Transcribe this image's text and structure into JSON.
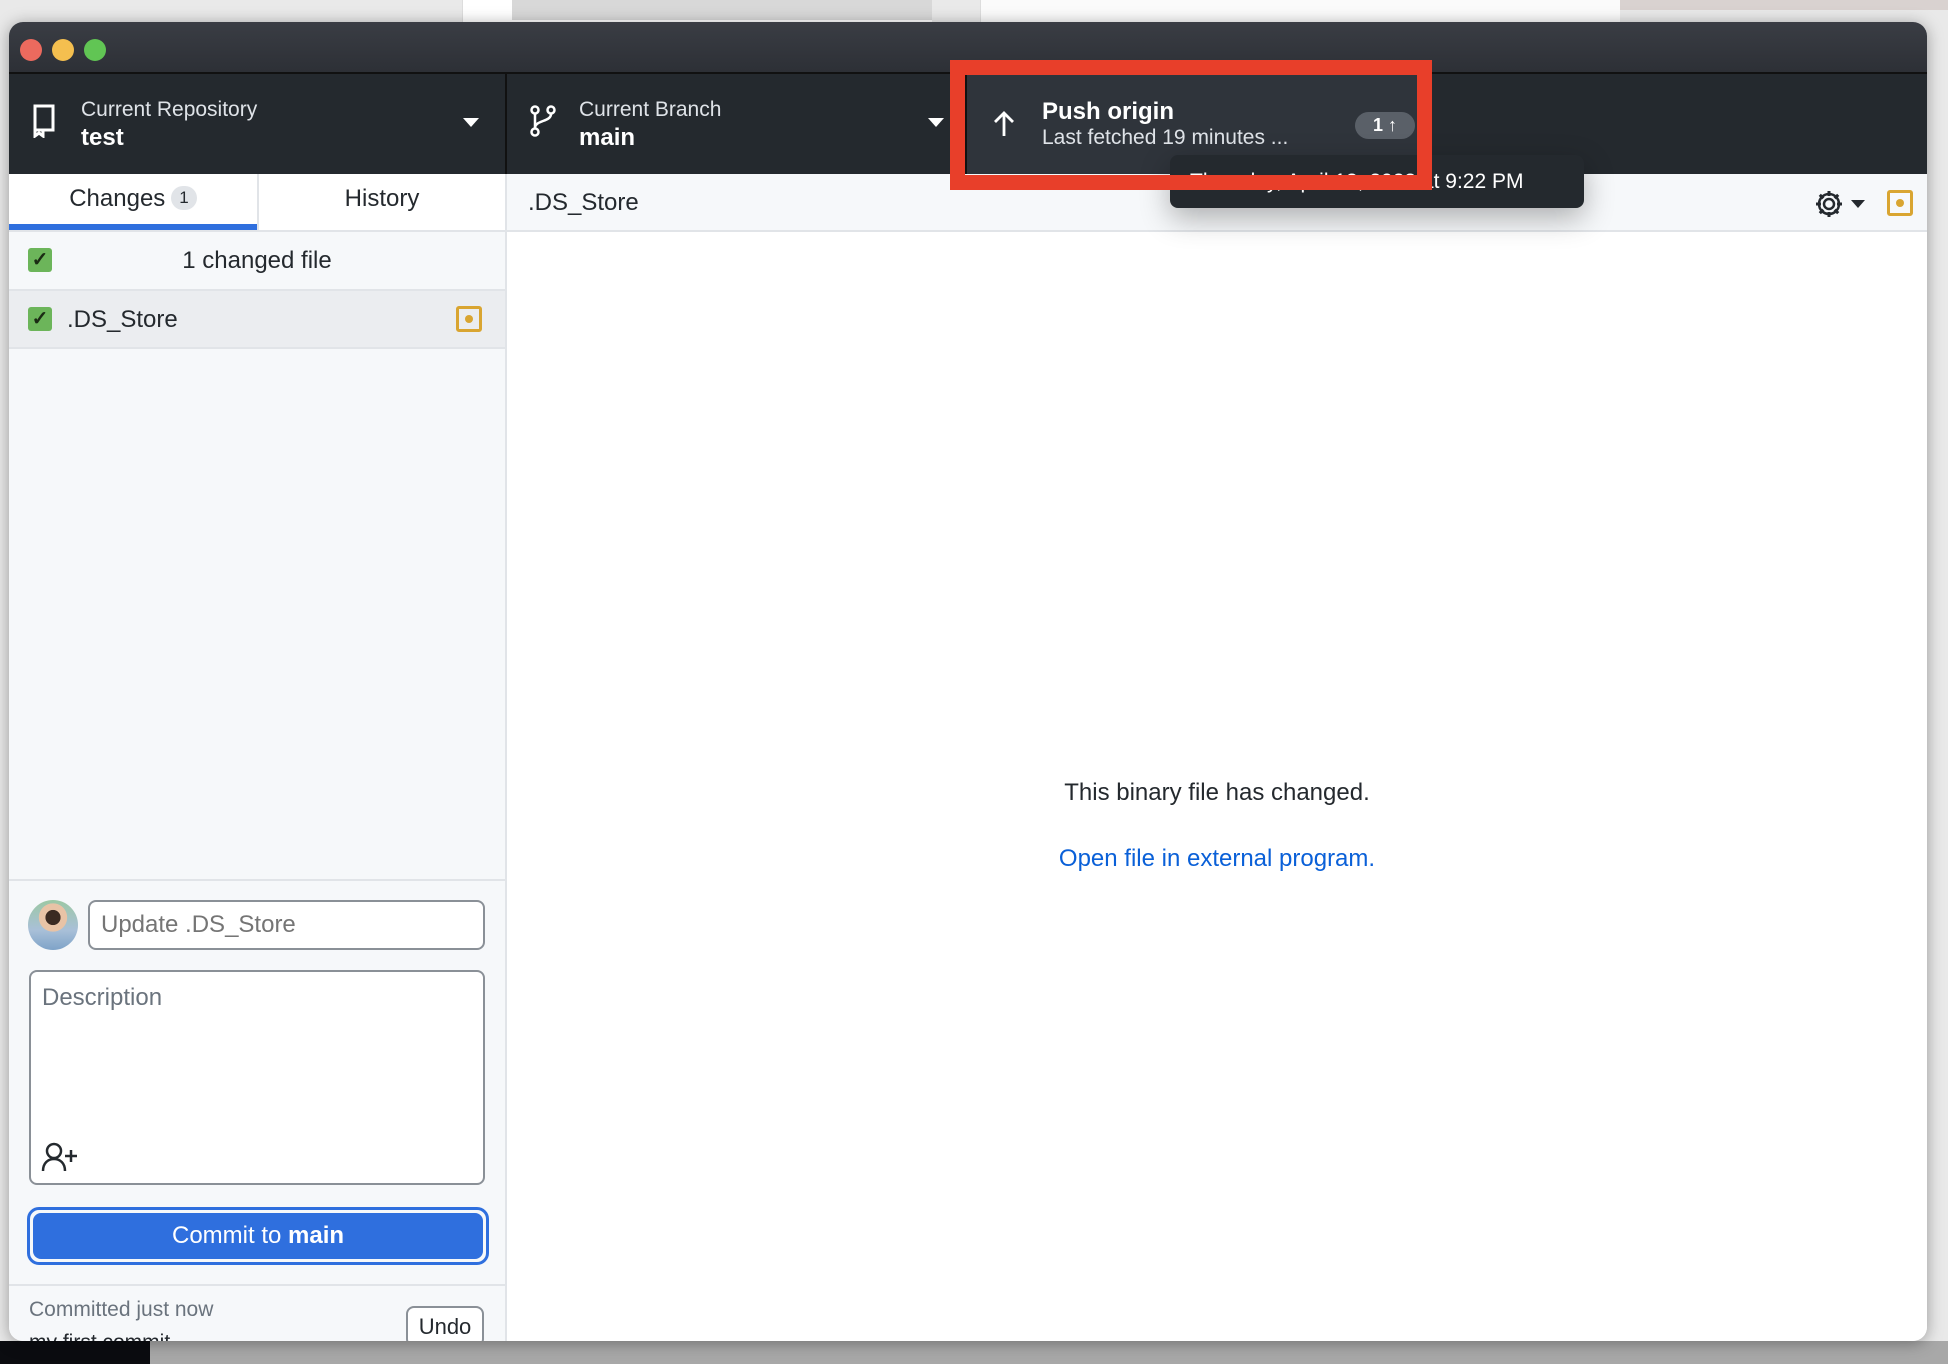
{
  "toolbar": {
    "repository": {
      "label": "Current Repository",
      "value": "test",
      "icon": "repo-icon"
    },
    "branch": {
      "label": "Current Branch",
      "value": "main",
      "icon": "git-branch-icon"
    },
    "push": {
      "label": "Push origin",
      "status": "Last fetched 19 minutes ...",
      "ahead_count": "1",
      "icon": "arrow-up-icon"
    },
    "tooltip": "Thursday, April 13, 2023 at 9:22 PM"
  },
  "sidebar": {
    "tabs": [
      {
        "label": "Changes",
        "count": "1",
        "active": true
      },
      {
        "label": "History",
        "active": false
      }
    ],
    "changed_header": "1 changed file",
    "files": [
      {
        "name": ".DS_Store",
        "checked": true,
        "status": "modified"
      }
    ]
  },
  "commit": {
    "summary_placeholder": "Update .DS_Store",
    "description_placeholder": "Description",
    "button_prefix": "Commit to ",
    "button_branch": "main",
    "last_commit_time": "Committed just now",
    "last_commit_message": "my first commit",
    "undo_label": "Undo"
  },
  "diff": {
    "file_name": ".DS_Store",
    "message": "This binary file has changed.",
    "link": "Open file in external program."
  },
  "colors": {
    "accent": "#2f6fde",
    "highlight": "#e83f2a",
    "modified": "#d9a531",
    "toolbar": "#24292e"
  }
}
